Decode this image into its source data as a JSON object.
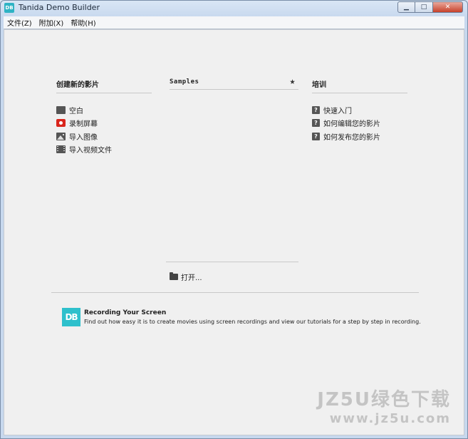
{
  "window": {
    "title": "Tanida Demo Builder",
    "icon": "DB",
    "controls": {
      "minimize": "▁",
      "maximize": "□",
      "close": "✕"
    }
  },
  "menubar": [
    "文件(Z)",
    "附加(X)",
    "帮助(H)"
  ],
  "create": {
    "heading": "创建新的影片",
    "items": [
      {
        "label": "空白",
        "icon": "blank-icon"
      },
      {
        "label": "录制屏幕",
        "icon": "record-icon"
      },
      {
        "label": "导入图像",
        "icon": "image-icon"
      },
      {
        "label": "导入视频文件",
        "icon": "film-icon"
      }
    ]
  },
  "samples": {
    "heading": "Samples",
    "star": "★",
    "open_label": "打开..."
  },
  "training": {
    "heading": "培训",
    "items": [
      {
        "label": "快速入门"
      },
      {
        "label": "如何编辑您的影片"
      },
      {
        "label": "如何发布您的影片"
      }
    ],
    "help_glyph": "?"
  },
  "tip": {
    "logo": "DB",
    "title": "Recording Your Screen",
    "description": "Find out how easy it is to create movies using screen recordings and view our tutorials for a step by step in recording."
  },
  "watermark": {
    "line1": "JZ5U绿色下载",
    "line2": "www.jz5u.com"
  },
  "colors": {
    "accent": "#2ec0cc",
    "record": "#d9251c",
    "background": "#f0f0f0"
  }
}
